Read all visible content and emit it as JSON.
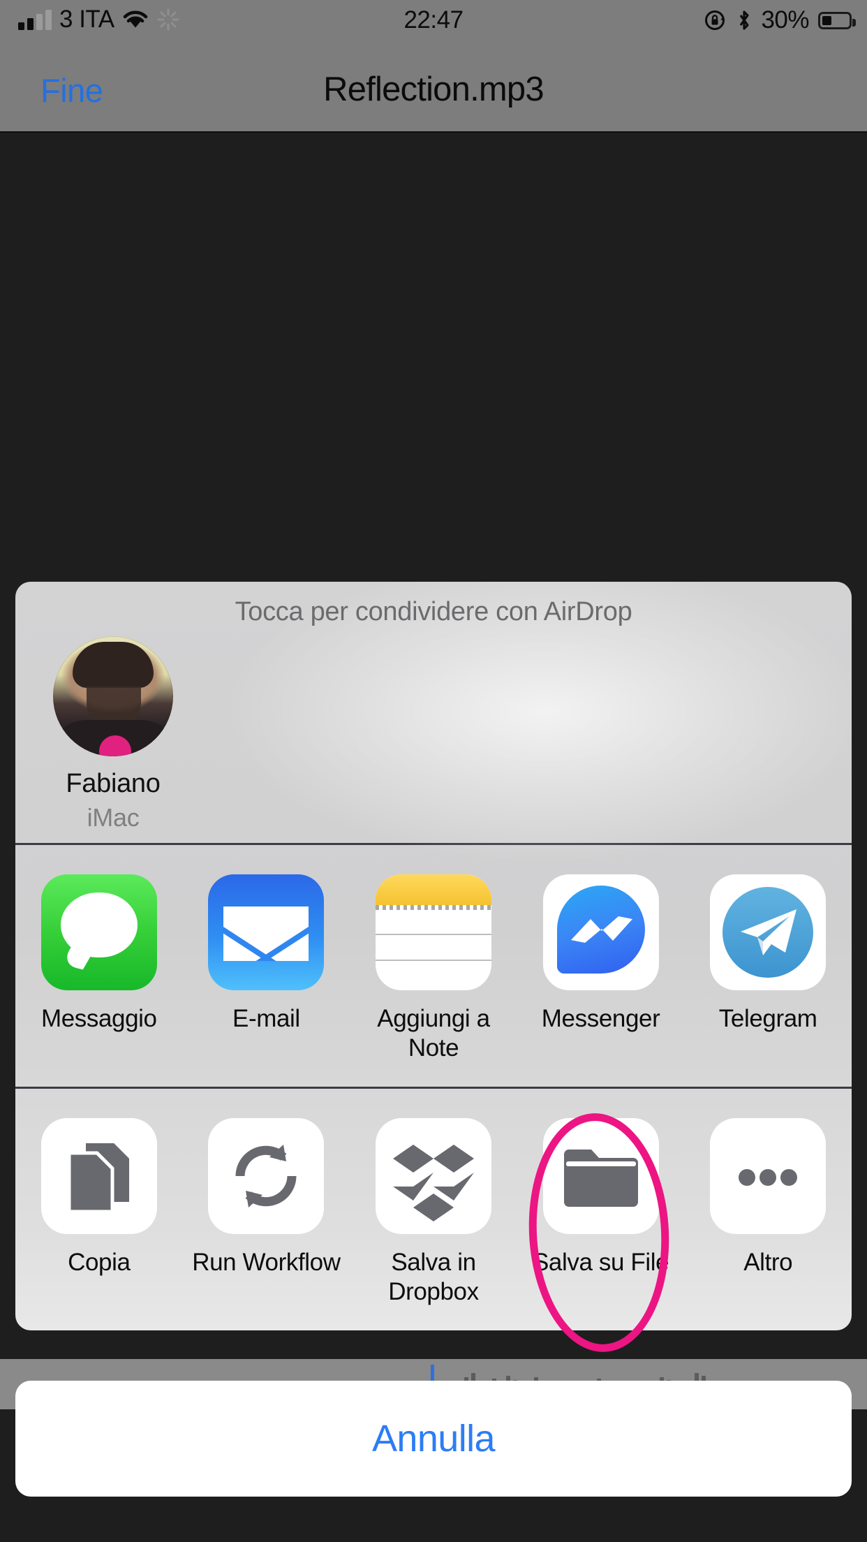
{
  "status_bar": {
    "carrier": "3 ITA",
    "time": "22:47",
    "battery_percent": "30%",
    "battery_level": 30,
    "signal_bars_filled": 2,
    "icons": [
      "signal-bars-icon",
      "wifi-icon",
      "activity-spinner-icon",
      "rotation-lock-icon",
      "bluetooth-icon",
      "battery-icon"
    ]
  },
  "nav_bar": {
    "done_label": "Fine",
    "title": "Reflection.mp3"
  },
  "share_sheet": {
    "airdrop": {
      "title": "Tocca per condividere con AirDrop",
      "contact_name": "Fabiano",
      "contact_device": "iMac"
    },
    "apps": [
      {
        "label": "Messaggio",
        "icon": "messages-icon"
      },
      {
        "label": "E-mail",
        "icon": "mail-icon"
      },
      {
        "label": "Aggiungi a Note",
        "icon": "notes-icon"
      },
      {
        "label": "Messenger",
        "icon": "messenger-icon"
      },
      {
        "label": "Telegram",
        "icon": "telegram-icon"
      }
    ],
    "actions": [
      {
        "label": "Copia",
        "icon": "copy-icon"
      },
      {
        "label": "Run Workflow",
        "icon": "refresh-circular-arrows-icon"
      },
      {
        "label": "Salva in Dropbox",
        "icon": "dropbox-icon"
      },
      {
        "label": "Salva su File",
        "icon": "folder-icon"
      },
      {
        "label": "Altro",
        "icon": "ellipsis-icon"
      }
    ],
    "highlighted_action": "Salva su File"
  },
  "cancel_button": {
    "label": "Annulla"
  },
  "colors": {
    "accent_blue": "#2c7df5",
    "annotation_pink": "#ec1583",
    "status_bar_gray": "#7d7d7d",
    "content_dark": "#1e1e1f",
    "sheet_gray": "#d3d3d4"
  }
}
